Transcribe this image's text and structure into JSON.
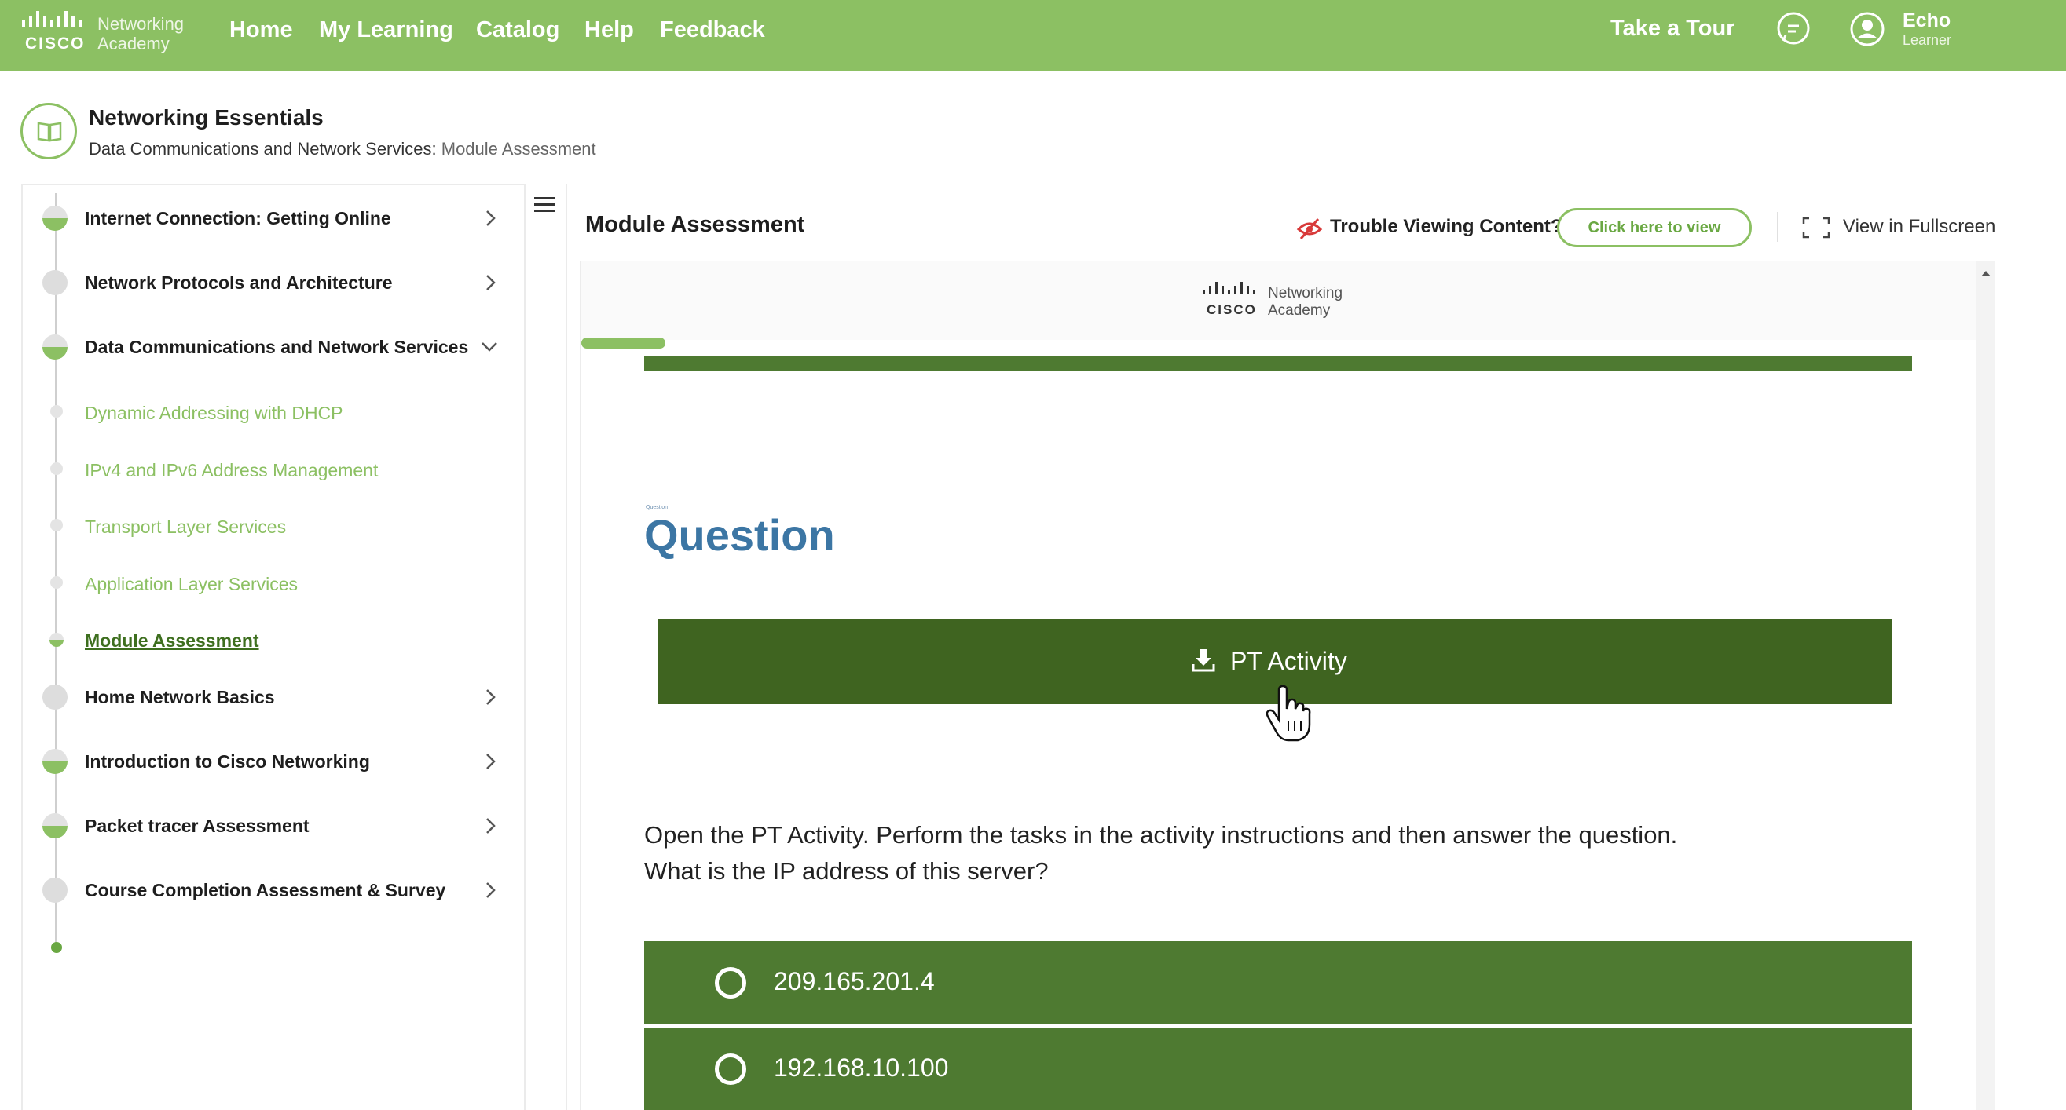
{
  "brand": {
    "name": "Networking",
    "sub": "Academy",
    "cisco": "CISCO"
  },
  "nav": {
    "items": [
      "Home",
      "My Learning",
      "Catalog",
      "Help",
      "Feedback"
    ]
  },
  "header": {
    "take_tour": "Take a Tour",
    "user": {
      "name": "Echo",
      "role": "Learner"
    }
  },
  "course": {
    "title": "Networking Essentials",
    "breadcrumb_parent": "Data Communications and Network Services:",
    "breadcrumb_current": "Module Assessment"
  },
  "sidebar": {
    "modules": [
      "Internet Connection: Getting Online",
      "Network Protocols and Architecture",
      "Data Communications and Network Services",
      "Home Network Basics",
      "Introduction to Cisco Networking",
      "Packet tracer Assessment",
      "Course Completion Assessment & Survey"
    ],
    "sub_items": [
      "Dynamic Addressing with DHCP",
      "IPv4 and IPv6 Address Management",
      "Transport Layer Services",
      "Application Layer Services",
      "Module Assessment"
    ],
    "active_sub_index": 4
  },
  "content": {
    "title": "Module Assessment",
    "trouble_text": "Trouble Viewing Content?",
    "view_button": "Click here to view",
    "fullscreen": "View in Fullscreen",
    "frame_logo": {
      "name": "Networking",
      "sub": "Academy",
      "cisco": "CISCO"
    },
    "progress": 0.06,
    "question_tiny": "Question",
    "question_heading": "Question",
    "pt_button": "PT Activity",
    "question_line1": "Open the PT Activity. Perform the tasks in the activity instructions and then answer the question.",
    "question_line2": "What is the IP address of this server?",
    "options": [
      "209.165.201.4",
      "192.168.10.100"
    ]
  },
  "colors": {
    "topbar": "#8cc063",
    "dark_green": "#3f6420",
    "option_green": "#4e7a31",
    "question_blue": "#3c76a4"
  }
}
